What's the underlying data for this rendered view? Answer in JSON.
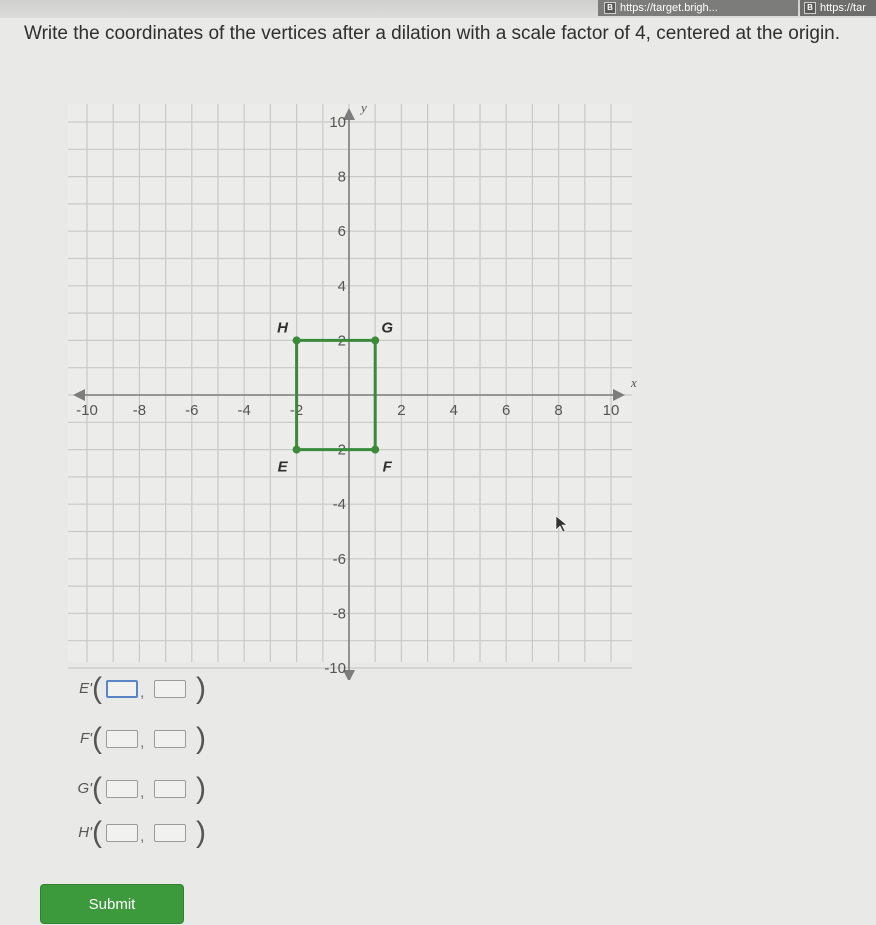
{
  "browser": {
    "tabs": [
      {
        "icon": "B",
        "label": "https://target.brigh..."
      },
      {
        "icon": "B",
        "label": "https://tar"
      }
    ]
  },
  "question": {
    "text": "Write the coordinates of the vertices after a dilation with a scale factor of 4, centered at the origin."
  },
  "graph": {
    "x_axis_label": "x",
    "y_axis_label": "y",
    "x_range": [
      -10,
      10
    ],
    "y_range": [
      -10,
      10
    ],
    "tick_labels": [
      -10,
      -8,
      -6,
      -4,
      -2,
      2,
      4,
      6,
      8,
      10
    ],
    "grid": true,
    "rectangle_color": "#3a8a3a",
    "axis_color": "#7d7d7d",
    "points": [
      {
        "name": "E",
        "x": -2,
        "y": -2,
        "label_pos": "bottom-left"
      },
      {
        "name": "F",
        "x": 1,
        "y": -2,
        "label_pos": "bottom-right"
      },
      {
        "name": "G",
        "x": 1,
        "y": 2,
        "label_pos": "top-right"
      },
      {
        "name": "H",
        "x": -2,
        "y": 2,
        "label_pos": "top-left"
      }
    ]
  },
  "answers": [
    {
      "label": "E'",
      "x_value": "",
      "y_value": "",
      "active": true
    },
    {
      "label": "F'",
      "x_value": "",
      "y_value": "",
      "active": false
    },
    {
      "label": "G'",
      "x_value": "",
      "y_value": "",
      "active": false
    },
    {
      "label": "H'",
      "x_value": "",
      "y_value": "",
      "active": false
    }
  ],
  "submit_label": "Submit"
}
